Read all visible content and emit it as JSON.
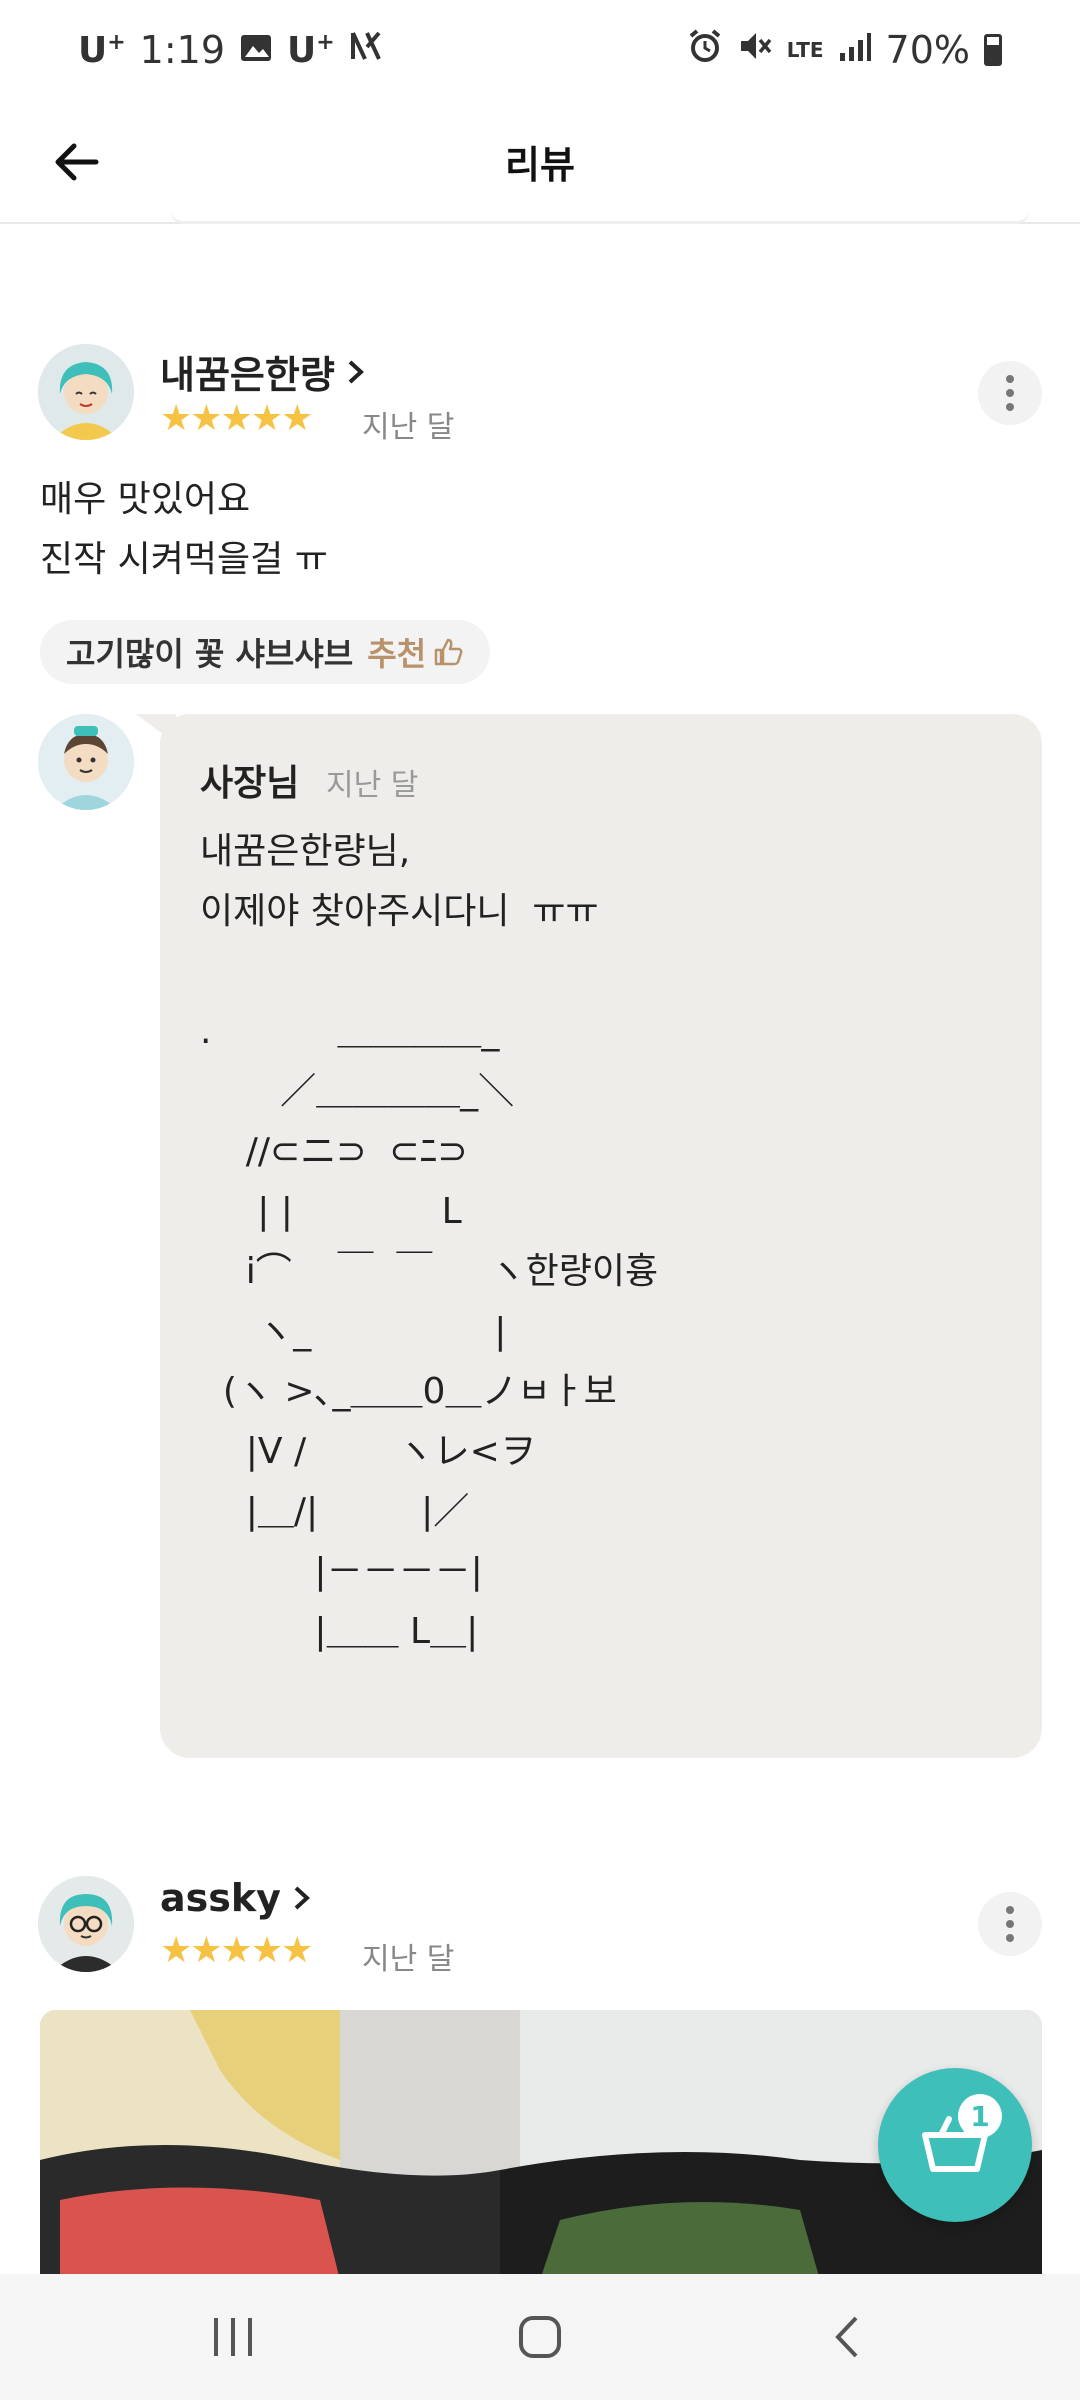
{
  "status_bar": {
    "carrier": "U",
    "carrier_sup": "+",
    "time": "1:19",
    "carrier2": "U",
    "network_type": "LTE",
    "battery": "70%"
  },
  "header": {
    "title": "리뷰"
  },
  "reviews": [
    {
      "name": "내꿈은한량",
      "stars": "★★★★★",
      "date": "지난 달",
      "text": "매우 맛있어요\n진작 시켜먹을걸 ㅠ",
      "menu_chip": {
        "menu": "고기많이 꽃 샤브샤브",
        "recommend": "추천"
      },
      "reply": {
        "author": "사장님",
        "date": "지난 달",
        "text": "내꿈은한량님,\n이제야 찾아주시다니  ㅠㅠ\n\n.           ＿＿＿＿_\n       ／＿＿＿＿_＼\n    //⊂ニ⊃  ⊂ﾆ⊃\n     | |             L\n    i⌒    ￣  ￣     ヽ한량이흉\n     ヽ_                |\n  (ヽ >､_＿＿0＿ノㅂㅏ보\n    |V /        ヽレ<ヲ\n    |＿/|         |／\n          |－－－－|\n          |＿＿ L＿|"
      }
    },
    {
      "name": "assky",
      "stars": "★★★★★",
      "date": "지난 달"
    }
  ],
  "cart": {
    "count": "1"
  },
  "colors": {
    "star": "#f6c243",
    "accent_teal": "#3fbfb9",
    "recommend": "#b8926a",
    "reply_bg": "#efedea"
  }
}
